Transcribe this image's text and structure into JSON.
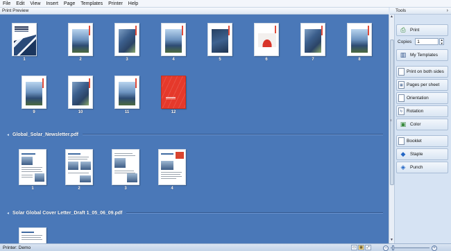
{
  "menu": [
    "File",
    "Edit",
    "View",
    "Insert",
    "Page",
    "Templates",
    "Printer",
    "Help"
  ],
  "preview": {
    "title": "Print Preview"
  },
  "tools": {
    "title": "Tools",
    "print_label": "Print",
    "copies_label": "Copies",
    "copies_value": "1",
    "my_templates": "My Templates",
    "print_both_sides": "Print on both sides",
    "pages_per_sheet": "Pages per sheet",
    "orientation": "Orientation",
    "rotation": "Rotation",
    "color": "Color",
    "booklet": "Booklet",
    "staple": "Staple",
    "punch": "Punch"
  },
  "documents": [
    {
      "name": "",
      "pages": [
        "1",
        "2",
        "3",
        "4",
        "5",
        "6",
        "7",
        "8",
        "9",
        "10",
        "11",
        "12"
      ]
    },
    {
      "name": "Global_Solar_Newsletter.pdf",
      "pages": [
        "1",
        "2",
        "3",
        "4"
      ]
    },
    {
      "name": "Solar Global Cover Letter_Draft 1_05_06_09.pdf",
      "pages": []
    }
  ],
  "status": {
    "printer": "Printer: Demo"
  },
  "colors": {
    "preview_bg": "#4a78b8",
    "accent_red": "#e5392b"
  }
}
